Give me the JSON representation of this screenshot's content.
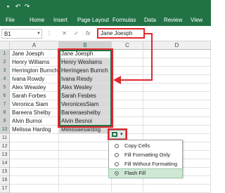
{
  "ribbon": {
    "tabs": [
      "File",
      "Home",
      "Insert",
      "Page Layout",
      "Formulas",
      "Data",
      "Review",
      "View"
    ],
    "active_tab": "Home"
  },
  "formula_bar": {
    "name_box": "B1",
    "fx_label": "fx",
    "formula": "Jane Joesph"
  },
  "grid": {
    "columns": [
      "A",
      "B",
      "C",
      "D"
    ],
    "rows": [
      "1",
      "2",
      "3",
      "4",
      "5",
      "6",
      "7",
      "8",
      "9",
      "10",
      "11",
      "12",
      "13",
      "14",
      "15",
      "16",
      "17"
    ],
    "column_a": [
      "Jane Joesph",
      "Henry Williams",
      "Herrington Burnch",
      "Ivana Rowdy",
      "Alex Weasley",
      "Sarah Forbes",
      "Veronica Siam",
      "Bareera Shelby",
      "Alvin Burnoi",
      "Melissa Hardog"
    ],
    "column_b": [
      "Jane Joesph",
      "Henry Wesliams",
      "Herringesn Burnch",
      "Ivana Resdy",
      "Alex Wesley",
      "Sarah Fesbes",
      "VeronicesSiam",
      "Bareeraeshelby",
      "Alvin Besnoi",
      "Melissaesardog"
    ]
  },
  "flash_fill_menu": {
    "items": [
      "Copy Cells",
      "Fill Formatting Only",
      "Fill Without Formatting",
      "Flash Fill"
    ],
    "selected": "Flash Fill"
  },
  "colors": {
    "excel_green": "#217346",
    "annotation_red": "#e0282e",
    "fill_gray": "#d9d9d9"
  }
}
